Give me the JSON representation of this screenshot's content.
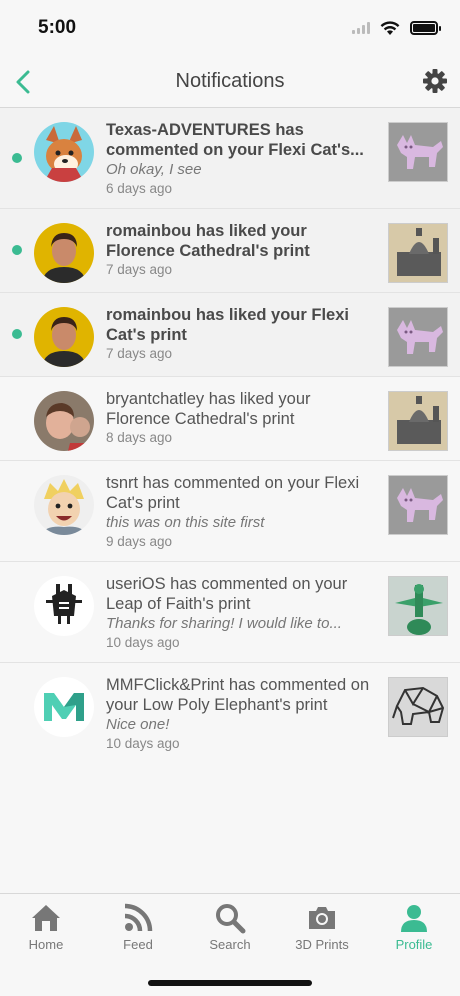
{
  "status_bar": {
    "time": "5:00"
  },
  "header": {
    "title": "Notifications"
  },
  "colors": {
    "accent": "#3bbb92",
    "text": "#444444",
    "muted": "#888888",
    "background": "#f7f7f7"
  },
  "icons": {
    "back": "chevron-left-icon",
    "settings": "gear-icon"
  },
  "notifications": [
    {
      "unread": true,
      "main": "Texas-ADVENTURES has commented on your Flexi Cat's...",
      "comment": "Oh okay, I see",
      "time": "6 days ago",
      "thumb": "flexi-cat"
    },
    {
      "unread": true,
      "main": "romainbou has liked your Florence Cathedral's print",
      "comment": "",
      "time": "7 days ago",
      "thumb": "cathedral"
    },
    {
      "unread": true,
      "main": "romainbou has liked your Flexi Cat's print",
      "comment": "",
      "time": "7 days ago",
      "thumb": "flexi-cat"
    },
    {
      "unread": false,
      "main": "bryantchatley has liked your Florence Cathedral's print",
      "comment": "",
      "time": "8 days ago",
      "thumb": "cathedral"
    },
    {
      "unread": false,
      "main": "tsnrt has commented on your Flexi Cat's print",
      "comment": "this was on this site first",
      "time": "9 days ago",
      "thumb": "flexi-cat"
    },
    {
      "unread": false,
      "main": "useriOS has commented on your Leap of Faith's print",
      "comment": "Thanks for sharing! I would like to...",
      "time": "10 days ago",
      "thumb": "leap-of-faith"
    },
    {
      "unread": false,
      "main": "MMFClick&Print has commented on your Low Poly Elephant's print",
      "comment": "Nice one!",
      "time": "10 days ago",
      "thumb": "elephant"
    }
  ],
  "tab_bar": {
    "tabs": [
      {
        "label": "Home",
        "icon": "home-icon"
      },
      {
        "label": "Feed",
        "icon": "rss-icon"
      },
      {
        "label": "Search",
        "icon": "search-icon"
      },
      {
        "label": "3D Prints",
        "icon": "camera-icon"
      },
      {
        "label": "Profile",
        "icon": "profile-icon",
        "active": true
      }
    ]
  }
}
